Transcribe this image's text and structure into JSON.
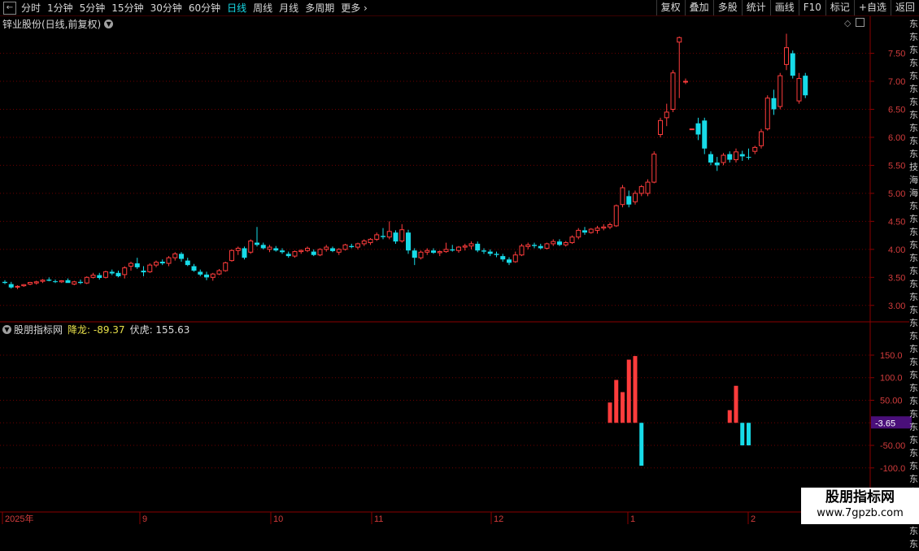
{
  "toolbar": {
    "periods": [
      "分时",
      "1分钟",
      "5分钟",
      "15分钟",
      "30分钟",
      "60分钟",
      "日线",
      "周线",
      "月线",
      "多周期"
    ],
    "active_period": "日线",
    "more_label": "更多",
    "tools": [
      "复权",
      "叠加",
      "多股",
      "统计",
      "画线",
      "F10",
      "标记",
      "+自选",
      "返回"
    ]
  },
  "stock": {
    "title": "锌业股份(日线,前复权)"
  },
  "indicator": {
    "name": "股朋指标网",
    "jianglong_label": "降龙: -89.37",
    "fuhu_label": "伏虎: 155.63",
    "current_value": "-3.65"
  },
  "price_axis": [
    "7.50",
    "7.00",
    "6.50",
    "6.00",
    "5.50",
    "5.00",
    "4.50",
    "4.00",
    "3.50",
    "3.00"
  ],
  "indicator_axis": [
    "150.0",
    "100.0",
    "50.00",
    "-50.00",
    "-100.0"
  ],
  "time_axis": [
    "2025年",
    "9",
    "10",
    "11",
    "12",
    "1",
    "2"
  ],
  "colors": {
    "up": "#ff3c3c",
    "down": "#17dbe8",
    "grid": "#6e0000",
    "border": "#8a0000",
    "badge": "#4a0f7a"
  },
  "sidebar_text": "东东东东东东东东东东东技海海东东东东东东东东东东东东东东东东东东东东东东东东东东东",
  "watermark": {
    "line1": "股朋指标网",
    "line2": "www.7gpzb.com"
  },
  "chart_data": {
    "type": "candlestick",
    "price_scale": {
      "ylim": [
        2.75,
        7.9
      ],
      "ticks": [
        3.0,
        3.5,
        4.0,
        4.5,
        5.0,
        5.5,
        6.0,
        6.5,
        7.0,
        7.5
      ]
    },
    "candles": [
      [
        3.42,
        3.45,
        3.38,
        3.4
      ],
      [
        3.38,
        3.42,
        3.3,
        3.32
      ],
      [
        3.33,
        3.36,
        3.29,
        3.34
      ],
      [
        3.35,
        3.38,
        3.33,
        3.37
      ],
      [
        3.38,
        3.42,
        3.36,
        3.41
      ],
      [
        3.4,
        3.44,
        3.37,
        3.42
      ],
      [
        3.43,
        3.47,
        3.4,
        3.45
      ],
      [
        3.46,
        3.5,
        3.43,
        3.44
      ],
      [
        3.43,
        3.46,
        3.4,
        3.42
      ],
      [
        3.42,
        3.45,
        3.4,
        3.44
      ],
      [
        3.45,
        3.48,
        3.42,
        3.4
      ],
      [
        3.38,
        3.44,
        3.36,
        3.42
      ],
      [
        3.42,
        3.46,
        3.38,
        3.4
      ],
      [
        3.4,
        3.52,
        3.38,
        3.5
      ],
      [
        3.5,
        3.58,
        3.48,
        3.54
      ],
      [
        3.54,
        3.58,
        3.46,
        3.49
      ],
      [
        3.5,
        3.62,
        3.48,
        3.6
      ],
      [
        3.6,
        3.64,
        3.54,
        3.57
      ],
      [
        3.58,
        3.62,
        3.5,
        3.52
      ],
      [
        3.55,
        3.7,
        3.48,
        3.67
      ],
      [
        3.7,
        3.78,
        3.62,
        3.75
      ],
      [
        3.75,
        3.85,
        3.65,
        3.68
      ],
      [
        3.62,
        3.7,
        3.52,
        3.59
      ],
      [
        3.6,
        3.75,
        3.58,
        3.72
      ],
      [
        3.72,
        3.8,
        3.68,
        3.77
      ],
      [
        3.78,
        3.82,
        3.72,
        3.75
      ],
      [
        3.75,
        3.88,
        3.7,
        3.85
      ],
      [
        3.85,
        3.95,
        3.8,
        3.92
      ],
      [
        3.92,
        3.95,
        3.78,
        3.83
      ],
      [
        3.8,
        3.85,
        3.7,
        3.72
      ],
      [
        3.7,
        3.74,
        3.6,
        3.62
      ],
      [
        3.6,
        3.64,
        3.52,
        3.55
      ],
      [
        3.55,
        3.6,
        3.45,
        3.5
      ],
      [
        3.5,
        3.58,
        3.44,
        3.56
      ],
      [
        3.56,
        3.65,
        3.54,
        3.62
      ],
      [
        3.62,
        3.78,
        3.6,
        3.76
      ],
      [
        3.8,
        4.0,
        3.78,
        3.98
      ],
      [
        3.98,
        4.05,
        3.9,
        4.02
      ],
      [
        4.02,
        4.05,
        3.82,
        3.85
      ],
      [
        3.95,
        4.18,
        3.92,
        4.15
      ],
      [
        4.12,
        4.4,
        4.05,
        4.08
      ],
      [
        4.08,
        4.12,
        4.0,
        4.02
      ],
      [
        4.0,
        4.08,
        3.95,
        4.04
      ],
      [
        4.02,
        4.06,
        3.96,
        3.98
      ],
      [
        3.98,
        4.02,
        3.92,
        3.95
      ],
      [
        3.92,
        3.96,
        3.85,
        3.88
      ],
      [
        3.88,
        3.98,
        3.85,
        3.96
      ],
      [
        3.96,
        4.0,
        3.92,
        3.98
      ],
      [
        3.98,
        4.05,
        3.95,
        4.02
      ],
      [
        3.96,
        4.0,
        3.88,
        3.9
      ],
      [
        3.9,
        4.02,
        3.88,
        4.0
      ],
      [
        4.0,
        4.08,
        3.96,
        4.04
      ],
      [
        4.02,
        4.05,
        3.95,
        3.97
      ],
      [
        3.95,
        4.02,
        3.9,
        4.0
      ],
      [
        4.0,
        4.1,
        3.98,
        4.08
      ],
      [
        4.06,
        4.1,
        4.02,
        4.04
      ],
      [
        4.04,
        4.12,
        4.0,
        4.1
      ],
      [
        4.1,
        4.18,
        4.06,
        4.15
      ],
      [
        4.12,
        4.2,
        4.08,
        4.18
      ],
      [
        4.18,
        4.3,
        4.15,
        4.26
      ],
      [
        4.24,
        4.38,
        4.18,
        4.22
      ],
      [
        4.22,
        4.5,
        4.18,
        4.32
      ],
      [
        4.3,
        4.34,
        4.1,
        4.14
      ],
      [
        4.15,
        4.45,
        4.12,
        4.35
      ],
      [
        4.3,
        4.35,
        3.92,
        3.98
      ],
      [
        3.98,
        4.02,
        3.72,
        3.85
      ],
      [
        3.85,
        3.98,
        3.82,
        3.95
      ],
      [
        3.95,
        4.02,
        3.9,
        3.98
      ],
      [
        3.98,
        4.02,
        3.92,
        3.94
      ],
      [
        3.94,
        3.98,
        3.88,
        3.96
      ],
      [
        3.96,
        4.12,
        3.94,
        4.0
      ],
      [
        4.0,
        4.08,
        3.96,
        3.98
      ],
      [
        3.98,
        4.06,
        3.94,
        4.04
      ],
      [
        4.04,
        4.1,
        3.98,
        4.06
      ],
      [
        4.06,
        4.14,
        4.0,
        4.1
      ],
      [
        4.1,
        4.14,
        3.95,
        3.98
      ],
      [
        3.98,
        4.02,
        3.92,
        3.96
      ],
      [
        3.96,
        4.0,
        3.88,
        3.92
      ],
      [
        3.92,
        3.96,
        3.86,
        3.9
      ],
      [
        3.88,
        3.92,
        3.78,
        3.82
      ],
      [
        3.82,
        3.86,
        3.72,
        3.76
      ],
      [
        3.78,
        3.96,
        3.76,
        3.9
      ],
      [
        3.9,
        4.1,
        3.88,
        4.06
      ],
      [
        4.05,
        4.12,
        4.0,
        4.08
      ],
      [
        4.08,
        4.12,
        4.02,
        4.06
      ],
      [
        4.06,
        4.1,
        4.0,
        4.02
      ],
      [
        4.02,
        4.12,
        4.0,
        4.1
      ],
      [
        4.1,
        4.18,
        4.06,
        4.14
      ],
      [
        4.14,
        4.18,
        4.06,
        4.08
      ],
      [
        4.08,
        4.15,
        4.05,
        4.12
      ],
      [
        4.12,
        4.25,
        4.1,
        4.22
      ],
      [
        4.22,
        4.38,
        4.18,
        4.34
      ],
      [
        4.34,
        4.4,
        4.26,
        4.3
      ],
      [
        4.3,
        4.38,
        4.28,
        4.36
      ],
      [
        4.34,
        4.42,
        4.28,
        4.38
      ],
      [
        4.38,
        4.45,
        4.34,
        4.4
      ],
      [
        4.4,
        4.48,
        4.36,
        4.44
      ],
      [
        4.42,
        4.8,
        4.4,
        4.78
      ],
      [
        4.8,
        5.15,
        4.75,
        5.1
      ],
      [
        4.95,
        5.05,
        4.75,
        4.8
      ],
      [
        4.85,
        5.05,
        4.8,
        5.0
      ],
      [
        5.0,
        5.15,
        4.95,
        5.12
      ],
      [
        5.0,
        5.25,
        4.95,
        5.2
      ],
      [
        5.2,
        5.75,
        5.18,
        5.7
      ],
      [
        6.05,
        6.35,
        6.0,
        6.3
      ],
      [
        6.35,
        6.6,
        6.2,
        6.45
      ],
      [
        6.5,
        7.2,
        6.45,
        7.15
      ],
      [
        7.7,
        7.8,
        6.7,
        7.78
      ],
      [
        7.0,
        7.05,
        6.95,
        7.0
      ],
      [
        6.15,
        6.15,
        6.15,
        6.15
      ],
      [
        6.25,
        6.35,
        5.95,
        6.05
      ],
      [
        6.3,
        6.35,
        5.7,
        5.8
      ],
      [
        5.7,
        5.75,
        5.5,
        5.55
      ],
      [
        5.55,
        5.65,
        5.4,
        5.5
      ],
      [
        5.55,
        5.72,
        5.5,
        5.68
      ],
      [
        5.7,
        5.75,
        5.55,
        5.6
      ],
      [
        5.6,
        5.8,
        5.55,
        5.74
      ],
      [
        5.7,
        5.76,
        5.58,
        5.66
      ],
      [
        5.65,
        5.8,
        5.6,
        5.64
      ],
      [
        5.75,
        5.85,
        5.7,
        5.82
      ],
      [
        5.85,
        6.15,
        5.8,
        6.1
      ],
      [
        6.15,
        6.75,
        6.12,
        6.7
      ],
      [
        6.7,
        6.85,
        6.4,
        6.5
      ],
      [
        6.55,
        7.15,
        6.5,
        7.1
      ],
      [
        7.3,
        7.85,
        7.2,
        7.6
      ],
      [
        7.5,
        7.55,
        7.05,
        7.1
      ],
      [
        6.65,
        7.15,
        6.6,
        7.05
      ],
      [
        7.1,
        7.15,
        6.7,
        6.75
      ]
    ],
    "indicator_scale": {
      "ylim": [
        -140,
        195
      ],
      "ticks": [
        150,
        100,
        50,
        0,
        -50,
        -100
      ]
    },
    "indicator_bars": [
      {
        "index": 96,
        "value": 45
      },
      {
        "index": 97,
        "value": 95
      },
      {
        "index": 98,
        "value": 68
      },
      {
        "index": 99,
        "value": 140
      },
      {
        "index": 100,
        "value": 148
      },
      {
        "index": 101,
        "value": -95
      },
      {
        "index": 115,
        "value": 28
      },
      {
        "index": 116,
        "value": 82
      },
      {
        "index": 117,
        "value": -50
      },
      {
        "index": 118,
        "value": -50
      }
    ]
  }
}
